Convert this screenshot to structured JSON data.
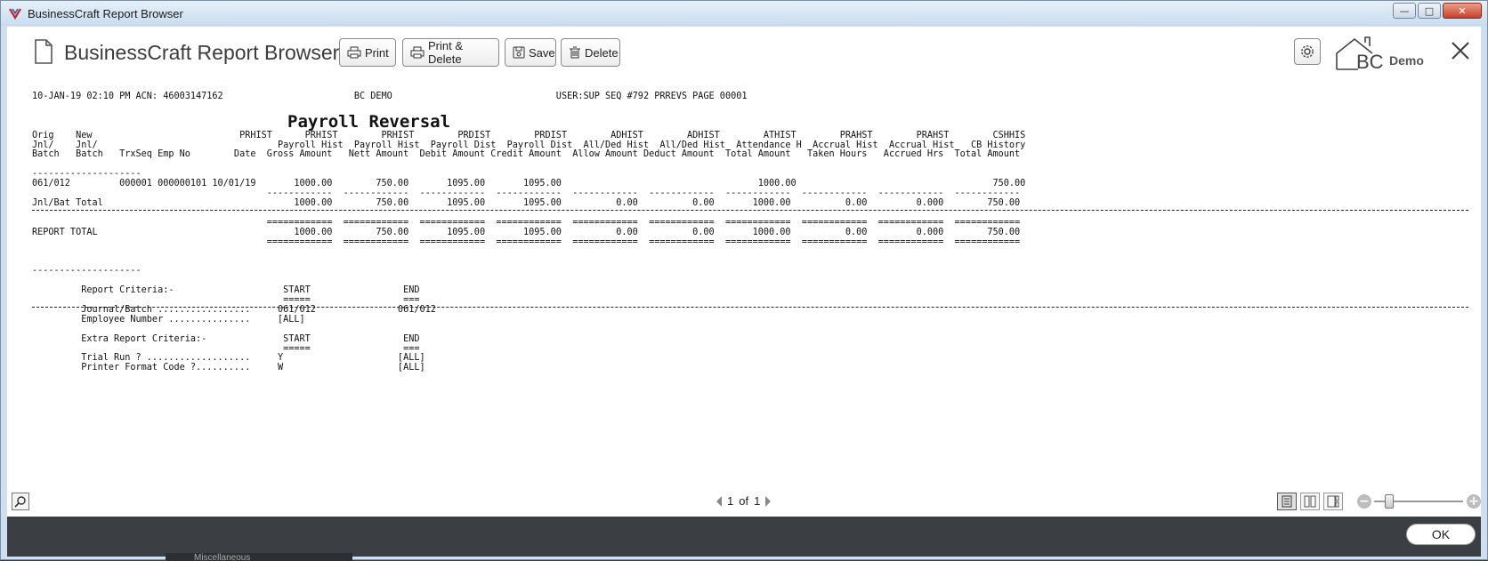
{
  "window": {
    "title": "BusinessCraft Report Browser",
    "controls": {
      "minimize": "—",
      "maximize": "□",
      "close": "✕"
    }
  },
  "toolbar": {
    "app_title": "BusinessCraft Report Browser",
    "print_label": "Print",
    "print_delete_label": "Print & Delete",
    "save_label": "Save",
    "delete_label": "Delete",
    "logo_text": "BC",
    "demo_label": "Demo"
  },
  "report": {
    "title": "Payroll Reversal",
    "text": "10-JAN-19 02:10 PM ACN: 46003147162                        BC DEMO                              USER:SUP SEQ #792 PRREVS PAGE 00001\n\n\n\nOrig    New                           PRHIST      PRHIST        PRHIST        PRDIST        PRDIST        ADHIST        ADHIST        ATHIST        PRAHST        PRAHST        CSHHIS\nJnl/    Jnl/                                 Payroll Hist  Payroll Hist  Payroll Dist  Payroll Dist  All/Ded Hist  All/Ded Hist  Attendance H  Accrual Hist  Accrual Hist   CB History\nBatch   Batch   TrxSeq Emp No        Date  Gross Amount   Nett Amount  Debit Amount Credit Amount  Allow Amount Deduct Amount  Total Amount   Taken Hours   Accrued Hrs  Total Amount\n\n--------------------\n061/012         000001 000000101 10/01/19       1000.00        750.00       1095.00       1095.00                                    1000.00                                    750.00\n                                           ------------  ------------  ------------  ------------  ------------  ------------  ------------  ------------  ------------  ------------\nJnl/Bat Total                                   1000.00        750.00       1095.00       1095.00          0.00          0.00       1000.00          0.00         0.000        750.00\n\n                                           ============  ============  ============  ============  ============  ============  ============  ============  ============  ============\nREPORT TOTAL                                    1000.00        750.00       1095.00       1095.00          0.00          0.00       1000.00          0.00         0.000        750.00\n                                           ============  ============  ============  ============  ============  ============  ============  ============  ============  ============\n\n\n--------------------\n\n         Report Criteria:-                    START                 END\n                                              =====                 ===\n         Journal/Batch .................     061/012               061/012\n         Employee Number ...............     [ALL]\n\n         Extra Report Criteria:-              START                 END\n                                              =====                 ===\n         Trial Run ? ...................     Y                     [ALL]\n         Printer Format Code ?..........     W                     [ALL]"
  },
  "footer": {
    "page_current": "1",
    "page_of": "of",
    "page_total": "1"
  },
  "dialog": {
    "ok_label": "OK"
  },
  "background": {
    "partial_text": "Miscellaneous"
  }
}
